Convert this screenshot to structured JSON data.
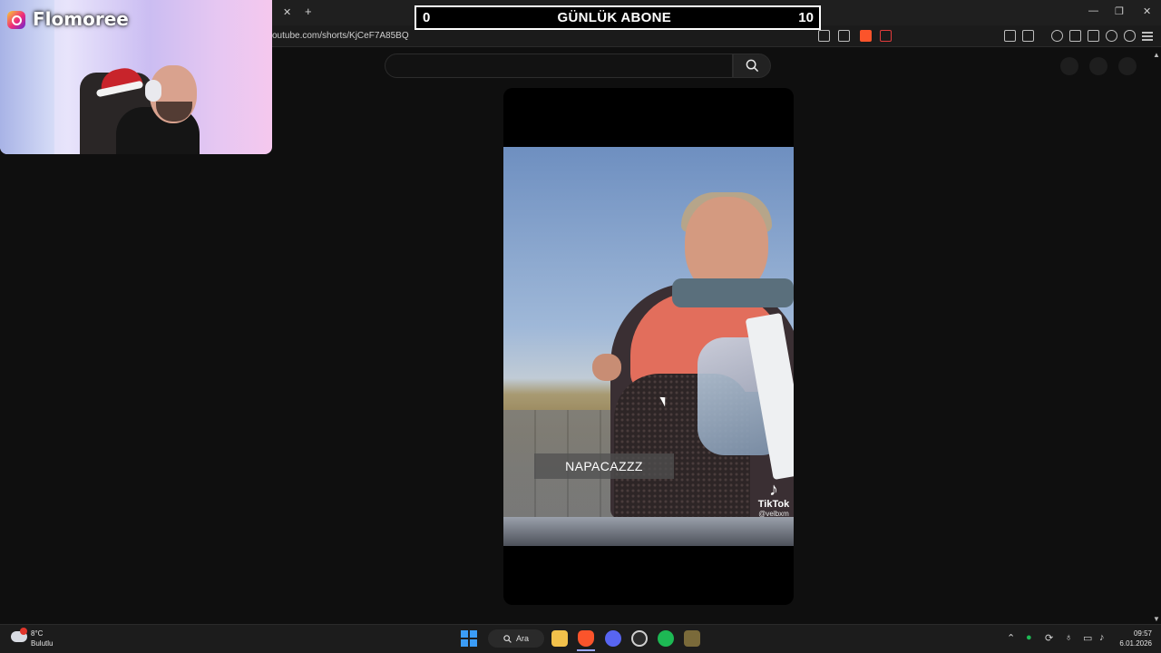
{
  "browser": {
    "url": "outube.com/shorts/KjCeF7A85BQ",
    "tab_close": "✕",
    "new_tab": "+",
    "window_controls": [
      "—",
      "❐",
      "✕"
    ]
  },
  "counter": {
    "left_value": "0",
    "label": "GÜNLÜK ABONE",
    "right_value": "10"
  },
  "webcam": {
    "streamer_name": "Flomoree",
    "icon": "instagram-icon"
  },
  "youtube": {
    "search_placeholder": "",
    "search_icon": "search-icon"
  },
  "short": {
    "caption": "NAPACAZZZ",
    "watermark_name": "TikTok",
    "watermark_handle": "@velbxm",
    "watermark_icon": "♪"
  },
  "taskbar": {
    "weather_temp": "8°C",
    "weather_desc": "Bulutlu",
    "search_label": "Ara",
    "time": "09:57",
    "date": "6.01.2026",
    "apps": [
      "file-explorer-icon",
      "brave-browser-icon",
      "discord-icon",
      "obs-icon",
      "spotify-icon",
      "app-icon"
    ]
  },
  "colors": {
    "accent": "#3b9cf6",
    "spotify": "#1db954",
    "brave": "#fb542b",
    "discord": "#5865f2"
  }
}
